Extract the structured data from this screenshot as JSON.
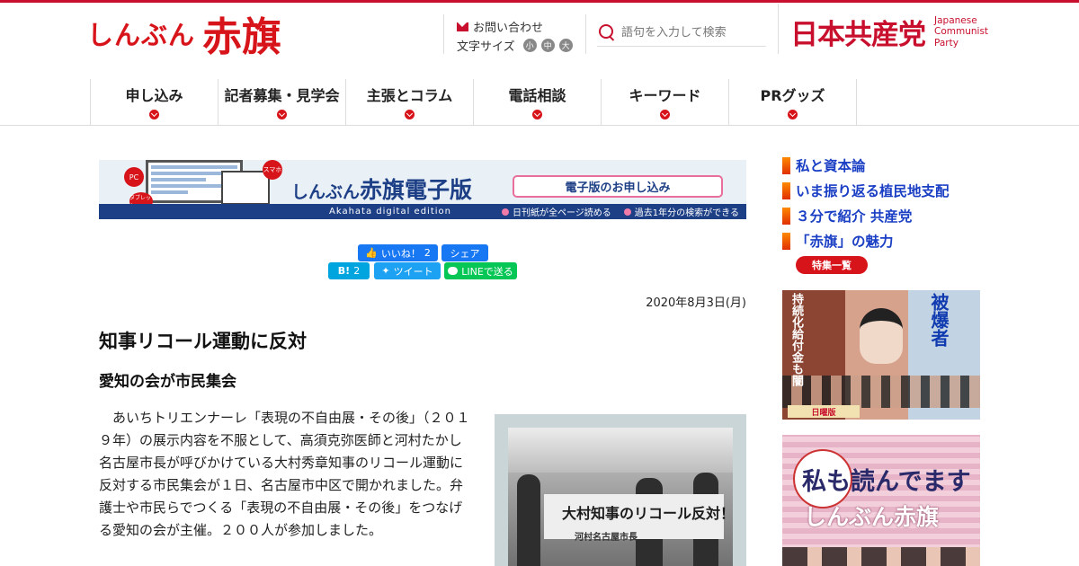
{
  "header": {
    "logo_small": "しんぶん",
    "logo_big": "赤旗",
    "contact_label": "お問い合わせ",
    "font_size_label": "文字サイズ",
    "font_sizes": [
      "小",
      "中",
      "大"
    ],
    "search_placeholder": "語句を入力して検索",
    "party_name": "日本共産党",
    "party_en_1": "Japanese",
    "party_en_2": "Communist",
    "party_en_3": "Party"
  },
  "nav": {
    "items": [
      "申し込み",
      "記者募集・見学会",
      "主張とコラム",
      "電話相談",
      "キーワード",
      "PRグッズ"
    ]
  },
  "banner": {
    "title_small": "しんぶん",
    "title_big": "赤旗電子版",
    "cta": "電子版のお申し込み",
    "en": "Akahata digital edition",
    "feature_1": "日刊紙が全ページ読める",
    "feature_2": "過去1年分の検索ができる",
    "badge_pc": "PC",
    "badge_phone": "スマホ",
    "badge_tablet": "タブレット"
  },
  "social": {
    "like_label": "いいね！",
    "like_count": "2",
    "share_label": "シェア",
    "hatena_label": "B!",
    "hatena_count": "2",
    "tweet_label": "ツイート",
    "line_label": "LINEで送る"
  },
  "article": {
    "date": "2020年8月3日(月)",
    "headline": "知事リコール運動に反対",
    "subhead": "愛知の会が市民集会",
    "body": "あいちトリエンナーレ「表現の不自由展・その後」（２０１９年）の展示内容を不服として、高須克弥医師と河村たかし名古屋市長が呼びかけている大村秀章知事のリコール運動に反対する市民集会が１日、名古屋市中区で開かれました。弁護士や市民らでつくる「表現の不自由展・その後」をつなげる愛知の会が主催。２００人が参加しました。",
    "photo_banner": "大村知事のリコール反対！",
    "photo_banner_sub": "河村名古屋市長"
  },
  "sidebar": {
    "links": [
      "私と資本論",
      "いま振り返る植民地支配",
      "３分で紹介 共産党",
      "「赤旗」の魅力"
    ],
    "special_button": "特集一覧",
    "sunday_text_1": "持続化給付金も闇",
    "sunday_text_2": "被爆者",
    "sunday_label": "日曜版",
    "promo_text_1": "私も読んでます",
    "promo_text_2": "しんぶん赤旗"
  }
}
